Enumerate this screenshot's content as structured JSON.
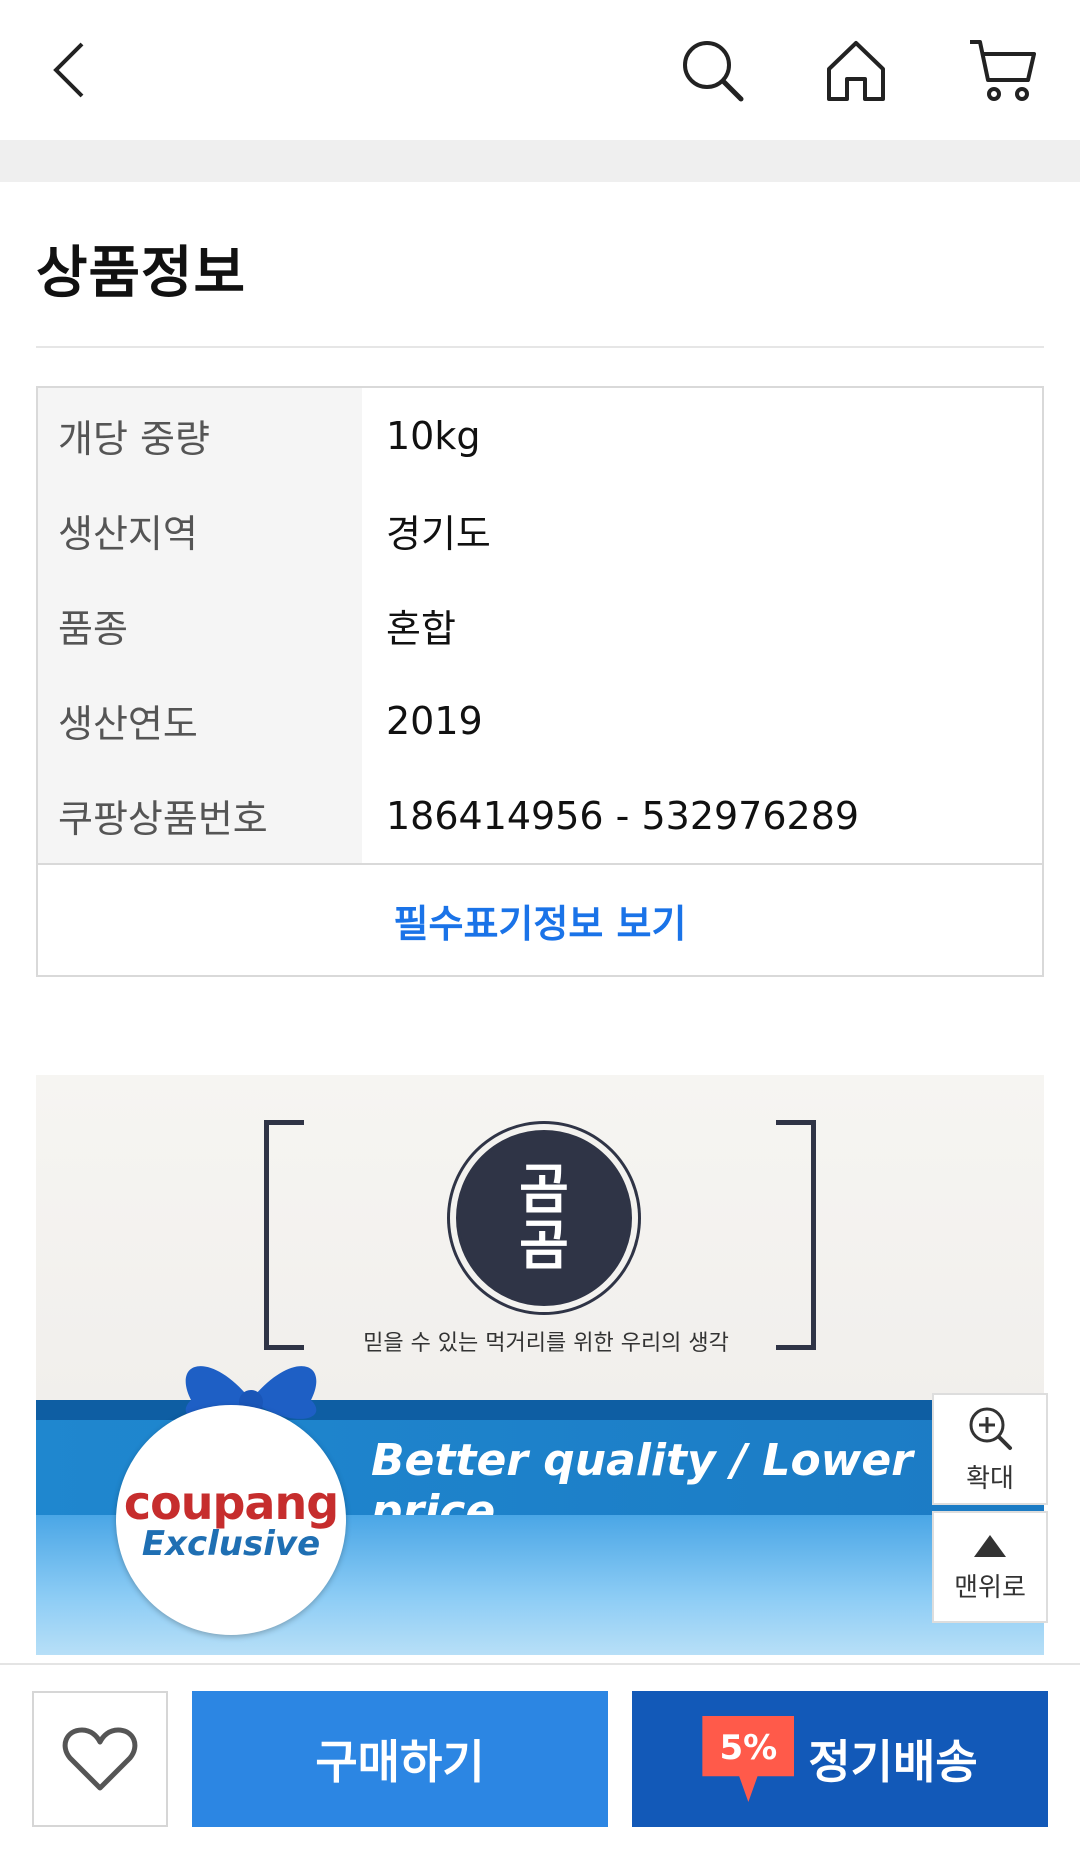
{
  "header": {
    "back_icon": "chevron-left-icon",
    "search_icon": "search-icon",
    "home_icon": "home-icon",
    "cart_icon": "cart-icon"
  },
  "section_title": "상품정보",
  "info_rows": [
    {
      "key": "개당 중량",
      "value": "10kg"
    },
    {
      "key": "생산지역",
      "value": "경기도"
    },
    {
      "key": "품종",
      "value": "혼합"
    },
    {
      "key": "생산연도",
      "value": "2019"
    },
    {
      "key": "쿠팡상품번호",
      "value": "186414956 - 532976289"
    }
  ],
  "info_link": "필수표기정보 보기",
  "banner": {
    "seal_text": "곰곰",
    "tagline": "믿을 수 있는 먹거리를 위한 우리의 생각",
    "band_text": "Better quality / Lower price",
    "badge_brand": "coupang",
    "badge_sub": "Exclusive"
  },
  "side_buttons": {
    "zoom_label": "확대",
    "top_label": "맨위로"
  },
  "bottom_bar": {
    "favorite_icon": "heart-icon",
    "buy_label": "구매하기",
    "subscription_discount": "5%",
    "subscription_label": "정기배송"
  },
  "colors": {
    "primary_blue": "#2c86e3",
    "dark_blue": "#1259b8",
    "discount_red": "#ff5a4a",
    "link_blue": "#1a73e8"
  }
}
